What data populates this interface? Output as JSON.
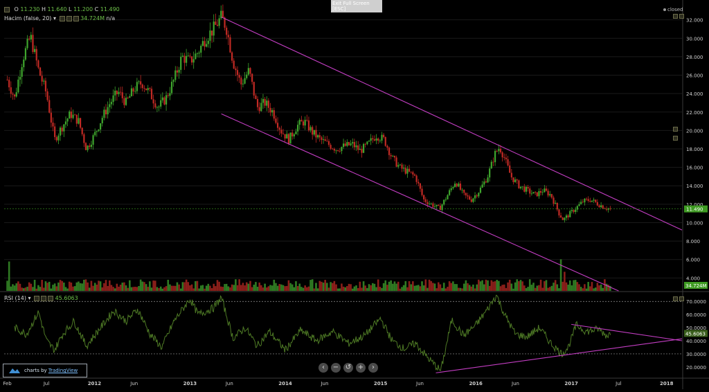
{
  "toolbar": {
    "exit_fullscreen": "Exit Full Screen",
    "exit_shortcut": "[ESC]",
    "status": "closed"
  },
  "ohlc": {
    "o_label": "O",
    "o": "11.230",
    "h_label": "H",
    "h": "11.640",
    "l_label": "L",
    "l": "11.200",
    "c_label": "C",
    "c": "11.490"
  },
  "volume_legend": {
    "label": "Hacim (false, 20)",
    "value": "34.724M",
    "extra": "n/a"
  },
  "rsi_legend": {
    "label": "RSI (14)",
    "value": "45.6063"
  },
  "branding": {
    "prefix": "charts by",
    "name": "TradingView"
  },
  "zoom_controls": [
    "‹",
    "−",
    "↺",
    "+",
    "›"
  ],
  "colors": {
    "up": "#3fa62d",
    "down": "#c22a24",
    "channel": "#c43ec4",
    "rsi_line": "#4e7a25",
    "grid": "#1a1a1a",
    "last_price_tag": "#3e9a22"
  },
  "chart_data": [
    {
      "type": "candlestick",
      "pane": "price",
      "title": "",
      "yaxis_ticks": [
        "32.000",
        "30.000",
        "28.000",
        "26.000",
        "24.000",
        "22.000",
        "20.000",
        "18.000",
        "16.000",
        "14.000",
        "12.000",
        "10.000",
        "8.000",
        "6.000",
        "4.000"
      ],
      "ylim": [
        2.6,
        33.1
      ],
      "xaxis_ticks": [
        "Feb",
        "Jul",
        "2012",
        "Jun",
        "2013",
        "Jun",
        "2014",
        "Jun",
        "2015",
        "Jun",
        "2016",
        "Jun",
        "2017",
        "Jul",
        "2018"
      ],
      "xlim": [
        "2011-01-20",
        "2018-03-01"
      ],
      "last_price": "11.490",
      "price_path": [
        [
          "2011-02-01",
          25.5
        ],
        [
          "2011-03-01",
          23.5
        ],
        [
          "2011-04-01",
          27.8
        ],
        [
          "2011-05-01",
          30.2
        ],
        [
          "2011-06-01",
          26.5
        ],
        [
          "2011-07-01",
          24.0
        ],
        [
          "2011-08-01",
          19.0
        ],
        [
          "2011-09-01",
          20.5
        ],
        [
          "2011-10-01",
          21.8
        ],
        [
          "2011-11-01",
          21.0
        ],
        [
          "2011-12-01",
          18.0
        ],
        [
          "2012-01-01",
          19.5
        ],
        [
          "2012-02-01",
          21.5
        ],
        [
          "2012-03-01",
          23.0
        ],
        [
          "2012-04-01",
          24.2
        ],
        [
          "2012-05-01",
          23.0
        ],
        [
          "2012-06-01",
          24.5
        ],
        [
          "2012-07-01",
          25.2
        ],
        [
          "2012-08-01",
          24.0
        ],
        [
          "2012-09-01",
          22.5
        ],
        [
          "2012-10-01",
          23.5
        ],
        [
          "2012-11-01",
          25.5
        ],
        [
          "2012-12-01",
          28.0
        ],
        [
          "2013-01-01",
          27.5
        ],
        [
          "2013-02-01",
          28.5
        ],
        [
          "2013-03-01",
          30.0
        ],
        [
          "2013-04-01",
          31.0
        ],
        [
          "2013-05-01",
          32.3
        ],
        [
          "2013-05-20",
          31.2
        ],
        [
          "2013-06-15",
          27.5
        ],
        [
          "2013-07-15",
          25.0
        ],
        [
          "2013-08-15",
          26.5
        ],
        [
          "2013-09-15",
          22.5
        ],
        [
          "2013-10-15",
          23.0
        ],
        [
          "2013-11-15",
          22.0
        ],
        [
          "2013-12-15",
          20.0
        ],
        [
          "2014-01-15",
          19.0
        ],
        [
          "2014-02-15",
          20.5
        ],
        [
          "2014-03-15",
          21.0
        ],
        [
          "2014-04-15",
          19.8
        ],
        [
          "2014-05-15",
          19.0
        ],
        [
          "2014-06-15",
          18.5
        ],
        [
          "2014-07-15",
          18.0
        ],
        [
          "2014-08-15",
          18.3
        ],
        [
          "2014-09-15",
          18.5
        ],
        [
          "2014-10-15",
          17.8
        ],
        [
          "2014-11-15",
          18.5
        ],
        [
          "2014-12-15",
          19.5
        ],
        [
          "2015-01-15",
          19.0
        ],
        [
          "2015-02-15",
          17.0
        ],
        [
          "2015-03-15",
          16.0
        ],
        [
          "2015-04-15",
          15.5
        ],
        [
          "2015-05-15",
          15.0
        ],
        [
          "2015-06-15",
          12.5
        ],
        [
          "2015-07-15",
          12.0
        ],
        [
          "2015-08-15",
          11.5
        ],
        [
          "2015-09-15",
          13.0
        ],
        [
          "2015-10-15",
          14.5
        ],
        [
          "2015-11-15",
          13.0
        ],
        [
          "2015-12-15",
          12.5
        ],
        [
          "2016-01-15",
          13.5
        ],
        [
          "2016-02-15",
          15.0
        ],
        [
          "2016-03-15",
          17.5
        ],
        [
          "2016-04-01",
          18.2
        ],
        [
          "2016-04-20",
          17.0
        ],
        [
          "2016-05-15",
          15.0
        ],
        [
          "2016-06-15",
          14.0
        ],
        [
          "2016-07-15",
          13.5
        ],
        [
          "2016-08-15",
          13.0
        ],
        [
          "2016-09-15",
          13.5
        ],
        [
          "2016-10-15",
          13.0
        ],
        [
          "2016-11-15",
          11.0
        ],
        [
          "2016-12-01",
          10.3
        ],
        [
          "2016-12-20",
          10.8
        ],
        [
          "2017-01-15",
          11.5
        ],
        [
          "2017-02-15",
          12.3
        ],
        [
          "2017-03-15",
          12.5
        ],
        [
          "2017-04-15",
          12.0
        ],
        [
          "2017-05-15",
          11.6
        ],
        [
          "2017-06-01",
          11.49
        ]
      ],
      "annotations": [
        {
          "type": "trendline",
          "color": "magenta",
          "from": [
            "2013-05-01",
            32.3
          ],
          "to": [
            "2018-03-01",
            9.2
          ]
        },
        {
          "type": "trendline",
          "color": "magenta",
          "from": [
            "2013-05-01",
            21.8
          ],
          "to": [
            "2017-07-01",
            2.6
          ]
        }
      ]
    },
    {
      "type": "bar",
      "pane": "volume",
      "series_name": "Hacim",
      "last_value": "34.724M",
      "ylim": [
        0,
        9.5
      ],
      "spikes": [
        [
          "2011-01-24",
          9.0
        ],
        [
          "2011-02-07",
          4.0
        ],
        [
          "2016-11-21",
          4.3
        ],
        [
          "2016-12-05",
          2.6
        ]
      ],
      "typical_range": [
        0.3,
        1.6
      ]
    },
    {
      "type": "line",
      "pane": "rsi",
      "series_name": "RSI (14)",
      "last_value": "45.6063",
      "ylim": [
        12,
        77
      ],
      "yaxis_ticks": [
        "70.0000",
        "60.0000",
        "50.0000",
        "40.0000",
        "30.0000",
        "20.0000"
      ],
      "bands": [
        70,
        30
      ],
      "rsi_path": [
        [
          "2011-03-01",
          50
        ],
        [
          "2011-04-15",
          45
        ],
        [
          "2011-06-01",
          62
        ],
        [
          "2011-07-01",
          40
        ],
        [
          "2011-08-01",
          33
        ],
        [
          "2011-09-01",
          45
        ],
        [
          "2011-10-15",
          55
        ],
        [
          "2011-12-01",
          36
        ],
        [
          "2012-02-01",
          52
        ],
        [
          "2012-03-15",
          63
        ],
        [
          "2012-05-01",
          55
        ],
        [
          "2012-06-15",
          64
        ],
        [
          "2012-08-01",
          45
        ],
        [
          "2012-09-15",
          35
        ],
        [
          "2012-11-01",
          55
        ],
        [
          "2013-01-01",
          72
        ],
        [
          "2013-02-01",
          60
        ],
        [
          "2013-04-01",
          65
        ],
        [
          "2013-05-01",
          73
        ],
        [
          "2013-06-15",
          42
        ],
        [
          "2013-08-01",
          50
        ],
        [
          "2013-09-15",
          36
        ],
        [
          "2013-11-01",
          47
        ],
        [
          "2014-01-01",
          33
        ],
        [
          "2014-03-01",
          48
        ],
        [
          "2014-05-01",
          40
        ],
        [
          "2014-07-01",
          47
        ],
        [
          "2014-09-01",
          38
        ],
        [
          "2014-11-01",
          44
        ],
        [
          "2015-01-01",
          57
        ],
        [
          "2015-02-15",
          40
        ],
        [
          "2015-04-01",
          34
        ],
        [
          "2015-05-15",
          38
        ],
        [
          "2015-07-01",
          27
        ],
        [
          "2015-08-20",
          17
        ],
        [
          "2015-10-01",
          56
        ],
        [
          "2015-11-15",
          44
        ],
        [
          "2016-01-01",
          52
        ],
        [
          "2016-02-15",
          64
        ],
        [
          "2016-03-20",
          75
        ],
        [
          "2016-04-20",
          60
        ],
        [
          "2016-06-01",
          45
        ],
        [
          "2016-07-15",
          43
        ],
        [
          "2016-09-01",
          50
        ],
        [
          "2016-10-15",
          38
        ],
        [
          "2016-11-25",
          30
        ],
        [
          "2016-12-20",
          35
        ],
        [
          "2017-01-20",
          52
        ],
        [
          "2017-03-01",
          47
        ],
        [
          "2017-04-15",
          49
        ],
        [
          "2017-05-15",
          44
        ],
        [
          "2017-06-01",
          45.6
        ]
      ],
      "annotations": [
        {
          "type": "trendline",
          "color": "magenta",
          "from": [
            "2015-08-01",
            15.5
          ],
          "to": [
            "2018-03-01",
            41.5
          ]
        },
        {
          "type": "trendline",
          "color": "magenta",
          "from": [
            "2017-01-01",
            52.5
          ],
          "to": [
            "2018-03-01",
            40.0
          ]
        }
      ]
    }
  ]
}
